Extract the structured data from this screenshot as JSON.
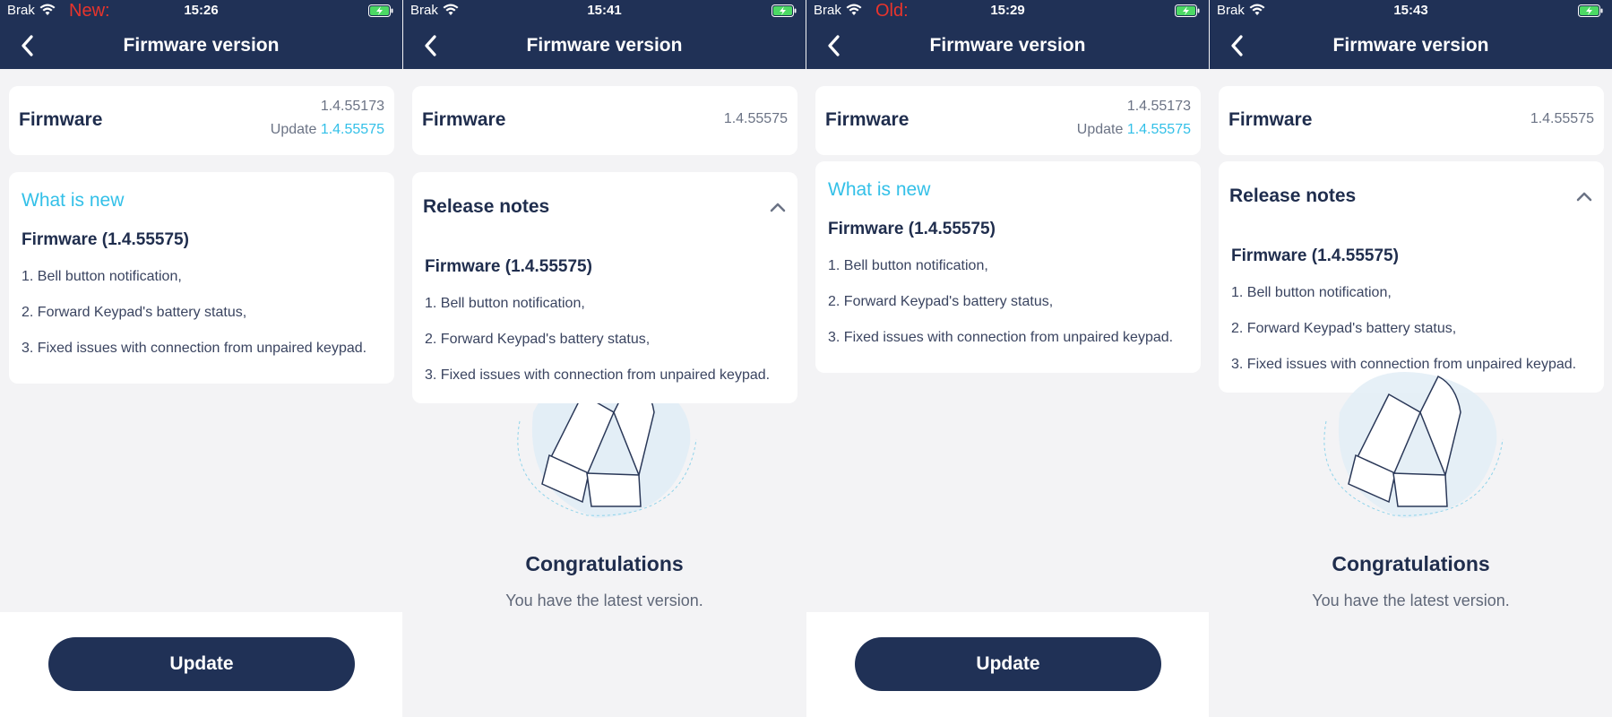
{
  "status": {
    "carrier": "Brak",
    "tag_new": "New:",
    "tag_old": "Old:",
    "times": [
      "15:26",
      "15:41",
      "15:29",
      "15:43"
    ]
  },
  "header": {
    "title": "Firmware version"
  },
  "firmware": {
    "label": "Firmware",
    "current": "1.4.55173",
    "update_prefix": "Update",
    "update_version": "1.4.55575",
    "latest": "1.4.55575"
  },
  "notes": {
    "what_is_new": "What is new",
    "release_notes": "Release notes",
    "version_title": "Firmware (1.4.55575)",
    "items": [
      "1. Bell button notification,",
      "2. Forward Keypad's battery status,",
      "3. Fixed issues with connection from unpaired keypad."
    ]
  },
  "congrats": {
    "title": "Congratulations",
    "subtitle": "You have the latest version."
  },
  "update_button": "Update",
  "colors": {
    "navy": "#203156",
    "accent": "#33c0e8",
    "alert": "#e8342c",
    "background": "#f3f3f5"
  }
}
